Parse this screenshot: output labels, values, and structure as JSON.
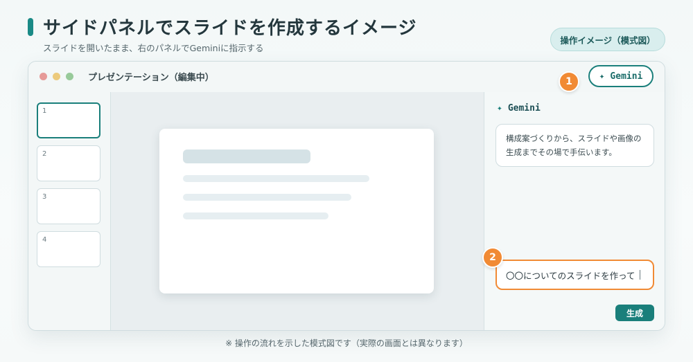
{
  "page": {
    "title": "サイドパネルでスライドを作成するイメージ",
    "subtitle": "スライドを開いたまま、右のパネルでGeminiに指示する",
    "mode_pill": "操作イメージ（模式図）",
    "footnote": "※ 操作の流れを示した模式図です（実際の画面とは異なります）"
  },
  "window": {
    "title": "プレゼンテーション（編集中）",
    "gemini_button": {
      "icon": "sparkle-icon",
      "label": "Gemini"
    },
    "badges": [
      "1",
      "2"
    ]
  },
  "thumbnails": [
    {
      "number": "1",
      "selected": true
    },
    {
      "number": "2",
      "selected": false
    },
    {
      "number": "3",
      "selected": false
    },
    {
      "number": "4",
      "selected": false
    }
  ],
  "side_panel": {
    "header": {
      "icon": "sparkle-icon",
      "label": "Gemini"
    },
    "message": "構成案づくりから、スライドや画像の生成までその場で手伝います。",
    "input_value": "〇〇についてのスライドを作って",
    "generate_button": "生成"
  },
  "colors": {
    "accent": "#1a7f7b",
    "badge": "#f18a34",
    "input_border": "#f18a34"
  }
}
